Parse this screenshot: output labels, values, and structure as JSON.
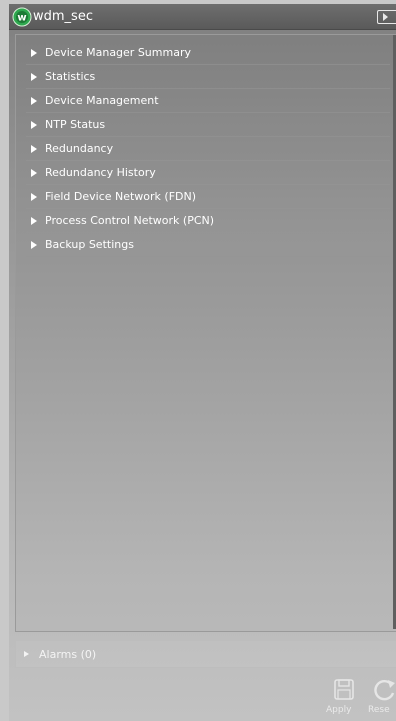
{
  "window": {
    "title": "wdm_sec",
    "icon": "w-circle-logo-icon"
  },
  "menu": {
    "items": [
      {
        "label": "Device Manager Summary"
      },
      {
        "label": "Statistics"
      },
      {
        "label": "Device Management"
      },
      {
        "label": "NTP Status"
      },
      {
        "label": "Redundancy"
      },
      {
        "label": "Redundancy History"
      },
      {
        "label": "Field Device Network (FDN)"
      },
      {
        "label": "Process Control Network (PCN)"
      },
      {
        "label": "Backup Settings"
      }
    ]
  },
  "alarms": {
    "label": "Alarms (0)"
  },
  "footer": {
    "apply_label": "Apply",
    "reset_label": "Rese"
  },
  "colors": {
    "logo_green": "#2fa84f",
    "text": "#ffffff"
  }
}
